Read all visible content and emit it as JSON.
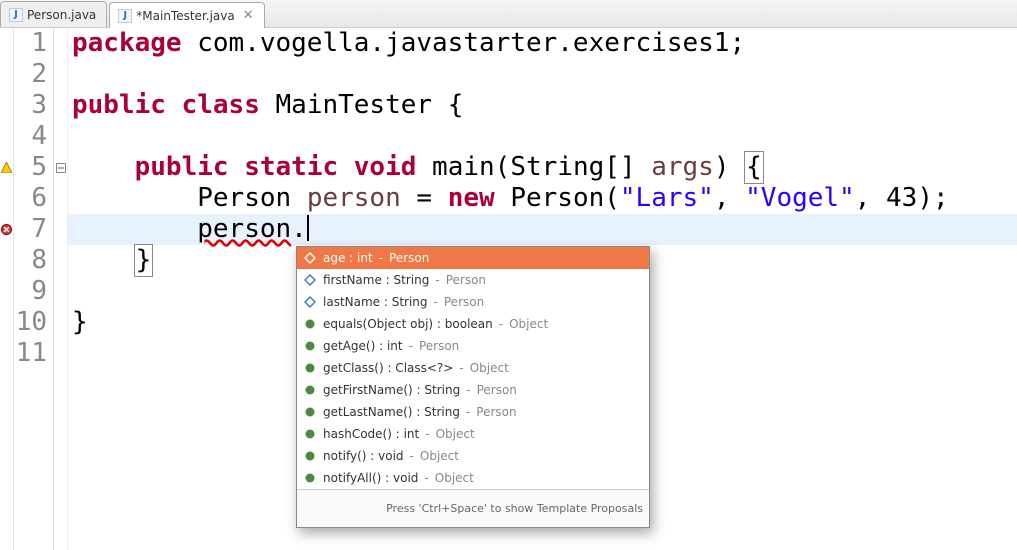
{
  "tabs": [
    {
      "label": "Person.java",
      "active": false
    },
    {
      "label": "*MainTester.java",
      "active": true
    }
  ],
  "gutter": [
    "1",
    "2",
    "3",
    "4",
    "5",
    "6",
    "7",
    "8",
    "9",
    "10",
    "11"
  ],
  "markers": {
    "5": "warning",
    "7": "error"
  },
  "code": {
    "l1": {
      "kw1": "package",
      "rest": " com.vogella.javastarter.exercises1;"
    },
    "l3": {
      "kw1": "public",
      "kw2": "class",
      "name": " MainTester ",
      "brace": "{"
    },
    "l5": {
      "indent": "    ",
      "kw1": "public",
      "kw2": "static",
      "kw3": "void",
      "name": " main(",
      "argtype": "String[]",
      "argname": " args",
      "close": ") ",
      "brace": "{"
    },
    "l6": {
      "indent": "        ",
      "type": "Person ",
      "var": "person",
      "eq": " = ",
      "kwnew": "new",
      "ctor": " Person(",
      "s1": "\"Lars\"",
      "c1": ", ",
      "s2": "\"Vogel\"",
      "c2": ", ",
      "n": "43",
      "end": ");"
    },
    "l7": {
      "indent": "        ",
      "expr": "person",
      "dot": "."
    },
    "l8": {
      "indent": "    ",
      "brace": "}"
    },
    "l10": {
      "brace": "}"
    }
  },
  "popup": {
    "items": [
      {
        "kind": "field",
        "sig": "age : int",
        "orig": "Person",
        "sel": true
      },
      {
        "kind": "field",
        "sig": "firstName : String",
        "orig": "Person"
      },
      {
        "kind": "field",
        "sig": "lastName : String",
        "orig": "Person"
      },
      {
        "kind": "method",
        "sig": "equals(Object obj) : boolean",
        "orig": "Object"
      },
      {
        "kind": "method",
        "sig": "getAge() : int",
        "orig": "Person"
      },
      {
        "kind": "method",
        "sig": "getClass() : Class<?>",
        "orig": "Object"
      },
      {
        "kind": "method",
        "sig": "getFirstName() : String",
        "orig": "Person"
      },
      {
        "kind": "method",
        "sig": "getLastName() : String",
        "orig": "Person"
      },
      {
        "kind": "method",
        "sig": "hashCode() : int",
        "orig": "Object"
      },
      {
        "kind": "method",
        "sig": "notify() : void",
        "orig": "Object"
      },
      {
        "kind": "method",
        "sig": "notifyAll() : void",
        "orig": "Object"
      }
    ],
    "footer": "Press 'Ctrl+Space' to show Template Proposals"
  }
}
